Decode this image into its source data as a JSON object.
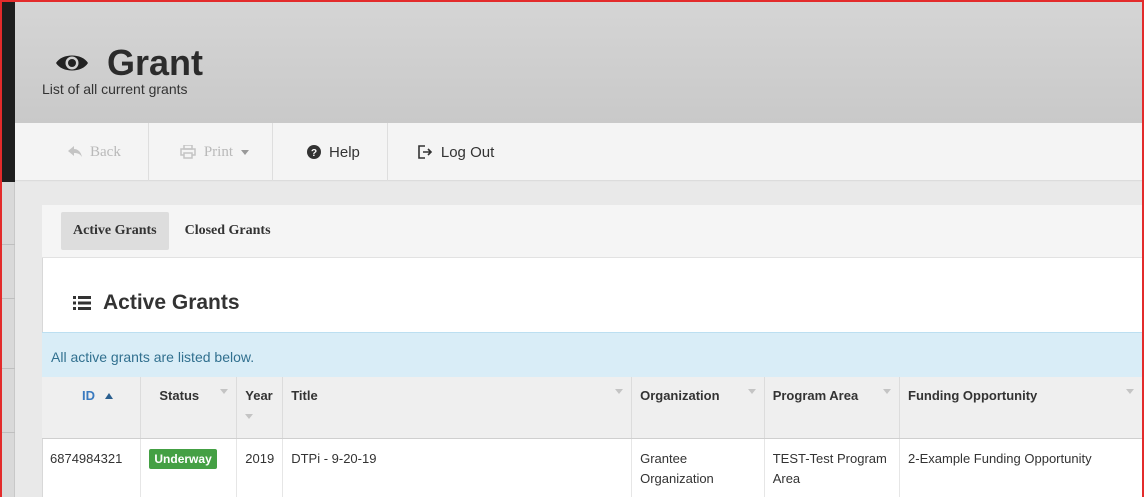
{
  "header": {
    "title": "Grant",
    "subtitle": "List of all current grants",
    "icon": "eye-icon"
  },
  "toolbar": {
    "back_label": "Back",
    "print_label": "Print",
    "help_label": "Help",
    "logout_label": "Log Out"
  },
  "tabs": [
    {
      "label": "Active Grants",
      "active": true
    },
    {
      "label": "Closed Grants",
      "active": false
    }
  ],
  "section": {
    "title": "Active Grants",
    "info": "All active grants are listed below."
  },
  "table": {
    "columns": [
      "ID",
      "Status",
      "Year",
      "Title",
      "Organization",
      "Program Area",
      "Funding Opportunity"
    ],
    "rows": [
      {
        "id": "6874984321",
        "status": "Underway",
        "year": "2019",
        "title": "DTPi - 9-20-19",
        "organization": "Grantee Organization",
        "program_area": "TEST-Test Program Area",
        "funding_opportunity": "2-Example Funding Opportunity"
      }
    ]
  },
  "colors": {
    "status_underway": "#44a044",
    "info_bg": "#d9edf7",
    "info_text": "#31708f",
    "frame_border": "#e32b2b"
  }
}
